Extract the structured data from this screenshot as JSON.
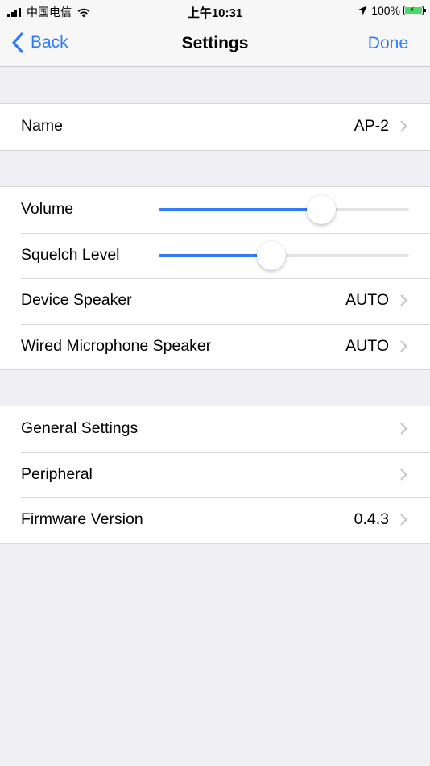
{
  "status_bar": {
    "carrier": "中国电信",
    "time": "上午10:31",
    "battery": "100%"
  },
  "nav": {
    "back_label": "Back",
    "title": "Settings",
    "done_label": "Done"
  },
  "name_row": {
    "label": "Name",
    "value": "AP-2"
  },
  "audio": {
    "volume": {
      "label": "Volume",
      "level": 0.65
    },
    "squelch": {
      "label": "Squelch Level",
      "level": 0.45
    },
    "device_speaker": {
      "label": "Device Speaker",
      "value": "AUTO"
    },
    "wired_mic_speaker": {
      "label": "Wired Microphone Speaker",
      "value": "AUTO"
    }
  },
  "more": {
    "general_settings": {
      "label": "General Settings"
    },
    "peripheral": {
      "label": "Peripheral"
    },
    "firmware": {
      "label": "Firmware Version",
      "value": "0.4.3"
    }
  },
  "colors": {
    "accent": "#2f7cf6",
    "background": "#efeff4",
    "separator": "#d8d8dc"
  }
}
